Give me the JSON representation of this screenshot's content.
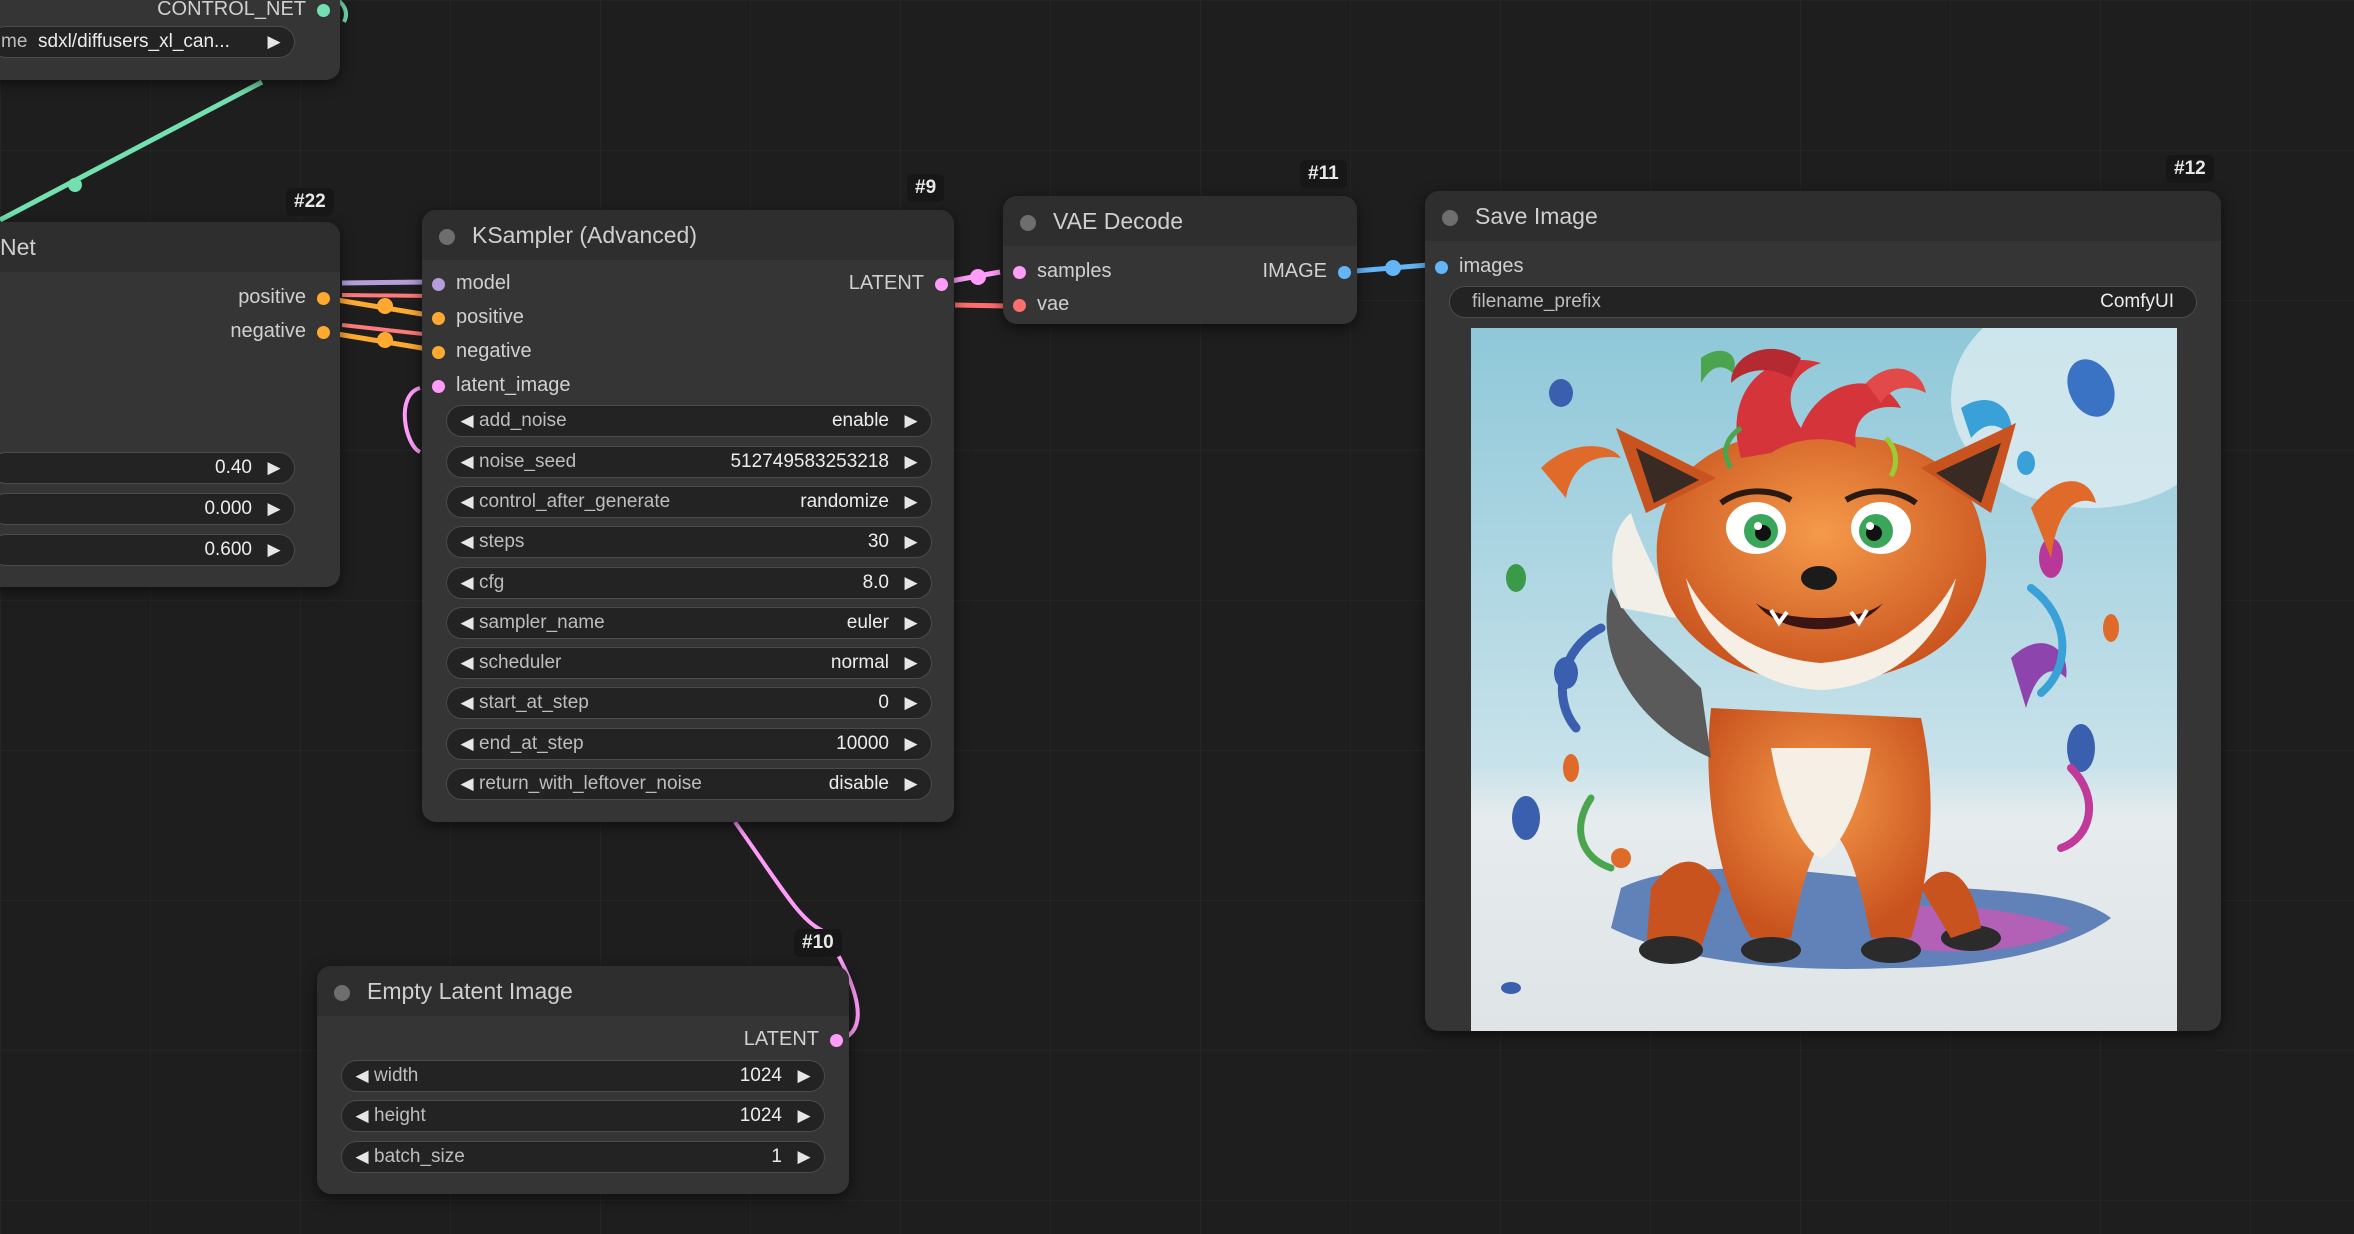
{
  "colors": {
    "canvas_bg": "#1e1e1e",
    "node_bg": "#353535",
    "model_slot": "#b39ddb",
    "conditioning_slot": "#ffa931",
    "latent_slot": "#ff9cf9",
    "vae_slot": "#ff6e6e",
    "image_slot": "#64b5f6",
    "control_net_slot": "#00d78d"
  },
  "controlnet_loader_node": {
    "output_label": "CONTROL_NET",
    "widget_name": "me",
    "widget_value": "sdxl/diffusers_xl_can..."
  },
  "controlnet_apply_node": {
    "title": "Net",
    "id": "#22",
    "outputs": [
      "positive",
      "negative"
    ],
    "widgets": [
      "0.40",
      "0.000",
      "0.600"
    ]
  },
  "ksampler_node": {
    "title": "KSampler (Advanced)",
    "id": "#9",
    "inputs": [
      "model",
      "positive",
      "negative",
      "latent_image"
    ],
    "output": "LATENT",
    "widgets": [
      {
        "name": "add_noise",
        "value": "enable"
      },
      {
        "name": "noise_seed",
        "value": "512749583253218"
      },
      {
        "name": "control_after_generate",
        "value": "randomize"
      },
      {
        "name": "steps",
        "value": "30"
      },
      {
        "name": "cfg",
        "value": "8.0"
      },
      {
        "name": "sampler_name",
        "value": "euler"
      },
      {
        "name": "scheduler",
        "value": "normal"
      },
      {
        "name": "start_at_step",
        "value": "0"
      },
      {
        "name": "end_at_step",
        "value": "10000"
      },
      {
        "name": "return_with_leftover_noise",
        "value": "disable"
      }
    ]
  },
  "vae_decode_node": {
    "title": "VAE Decode",
    "id": "#11",
    "inputs": [
      "samples",
      "vae"
    ],
    "output": "IMAGE"
  },
  "save_image_node": {
    "title": "Save Image",
    "id": "#12",
    "input": "images",
    "widget_name": "filename_prefix",
    "widget_value": "ComfyUI"
  },
  "empty_latent_node": {
    "title": "Empty Latent Image",
    "id": "#10",
    "output": "LATENT",
    "widgets": [
      {
        "name": "width",
        "value": "1024"
      },
      {
        "name": "height",
        "value": "1024"
      },
      {
        "name": "batch_size",
        "value": "1"
      }
    ]
  }
}
